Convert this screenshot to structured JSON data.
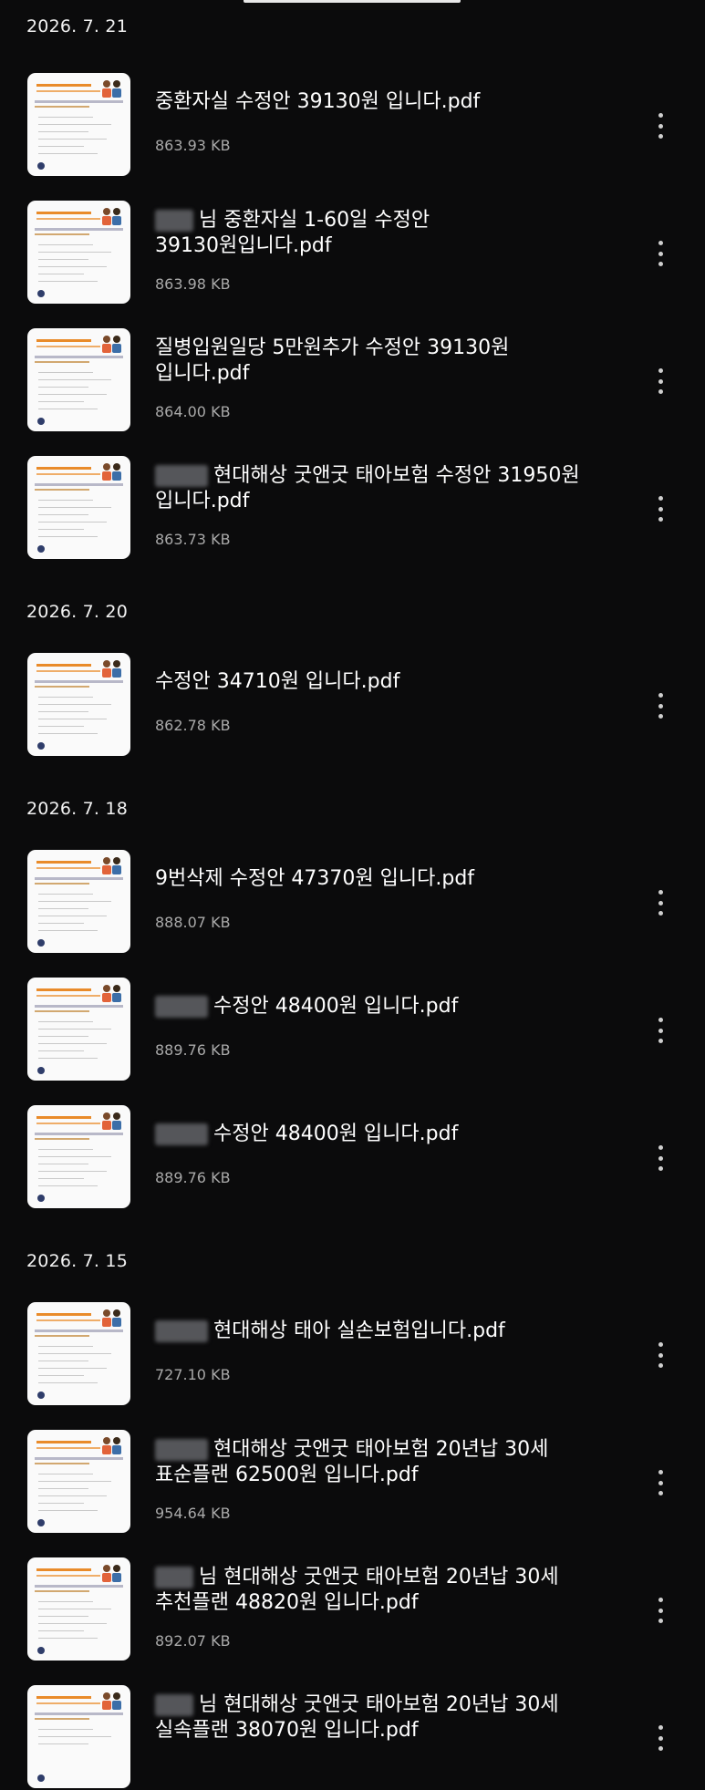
{
  "groups": [
    {
      "date": "2026. 7. 21",
      "files": [
        {
          "name": "중환자실 수정안 39130원 입니다.pdf",
          "size": "863.93 KB"
        },
        {
          "name": "님 중환자실 1-60일 수정안\n39130원입니다.pdf",
          "size": "863.98 KB"
        },
        {
          "name": "질병입원일당 5만원추가 수정안 39130원\n입니다.pdf",
          "size": "864.00 KB"
        },
        {
          "name": "현대해상 굿앤굿 태아보험 수정안 31950원\n입니다.pdf",
          "size": "863.73 KB"
        }
      ]
    },
    {
      "date": "2026. 7. 20",
      "files": [
        {
          "name": "수정안 34710원 입니다.pdf",
          "size": "862.78 KB"
        }
      ]
    },
    {
      "date": "2026. 7. 18",
      "files": [
        {
          "name": "9번삭제 수정안 47370원 입니다.pdf",
          "size": "888.07 KB"
        },
        {
          "name": "수정안 48400원 입니다.pdf",
          "size": "889.76 KB"
        },
        {
          "name": "수정안 48400원 입니다.pdf",
          "size": "889.76 KB"
        }
      ]
    },
    {
      "date": "2026. 7. 15",
      "files": [
        {
          "name": "현대해상 태아 실손보험입니다.pdf",
          "size": "727.10 KB"
        },
        {
          "name": "현대해상 굿앤굿 태아보험 20년납 30세\n표순플랜 62500원 입니다.pdf",
          "size": "954.64 KB"
        },
        {
          "name": "님 현대해상 굿앤굿 태아보험 20년납 30세\n추천플랜 48820원 입니다.pdf",
          "size": "892.07 KB"
        },
        {
          "name": "님 현대해상 굿앤굿 태아보험 20년납 30세\n실속플랜 38070원 입니다.pdf",
          "size": ""
        }
      ]
    }
  ],
  "icons": {
    "more": "more-vertical-icon",
    "thumbnail": "pdf-thumbnail-icon"
  },
  "colors": {
    "background": "#0b0b0c",
    "filename": "#ffffff",
    "filesize": "#a9a9a9",
    "thumbnail_accent": "#e98b2a"
  }
}
